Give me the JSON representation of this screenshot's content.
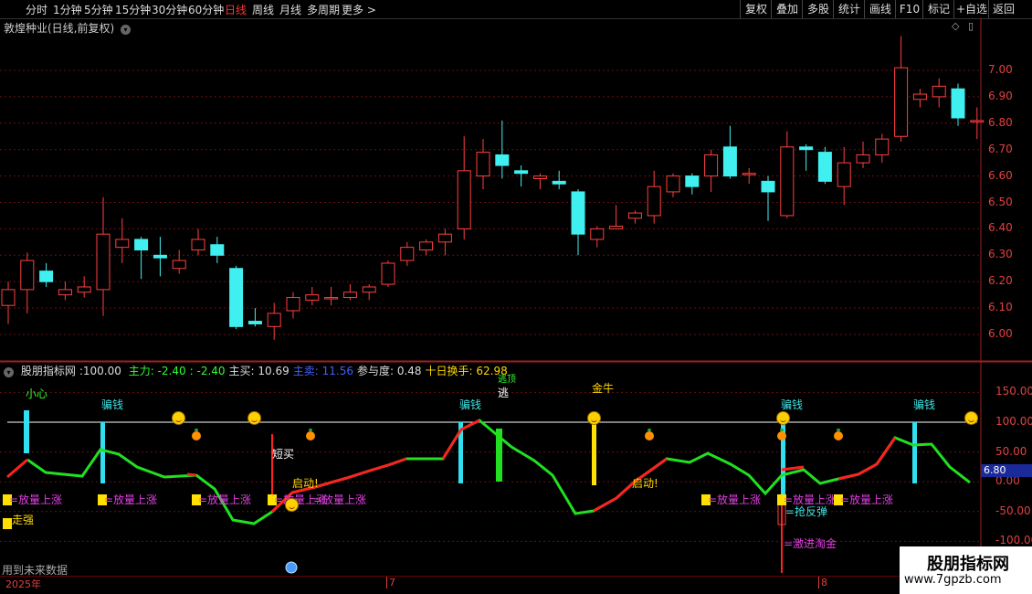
{
  "toolbar": {
    "periods": [
      "分时",
      "1分钟",
      "5分钟",
      "15分钟",
      "30分钟",
      "60分钟",
      "日线",
      "周线",
      "月线",
      "多周期",
      "更多 >"
    ],
    "active_period": "日线",
    "right_buttons": [
      "复权",
      "叠加",
      "多股",
      "统计",
      "画线",
      "F10",
      "标记",
      "+自选",
      "返回"
    ]
  },
  "main_panel": {
    "title": "敦煌种业(日线,前复权)",
    "y_labels": [
      "7.00",
      "6.90",
      "6.80",
      "6.70",
      "6.60",
      "6.50",
      "6.40",
      "6.30",
      "6.20",
      "6.10",
      "6.00"
    ]
  },
  "indicator": {
    "name": "股朋指标网",
    "param": ":100.00",
    "items": [
      {
        "text": "主力: -2.40",
        "color": "#30ff30"
      },
      {
        "text": ": -2.40",
        "color": "#30ff30"
      },
      {
        "text": "主买: 10.69",
        "color": "#dddddd"
      },
      {
        "text": "主卖: 11.56",
        "color": "#4060ff"
      },
      {
        "text": "参与度: 0.48",
        "color": "#dddddd"
      },
      {
        "text": "十日换手: 62.98",
        "color": "#ffd700"
      }
    ],
    "y_labels": [
      "150.00",
      "100.00",
      "50.00",
      "0.00",
      "-50.00",
      "-100.00"
    ],
    "current_price": "6.80"
  },
  "labels": {
    "xiaoxin": "小心",
    "pianqian": "骗钱",
    "jinniu": "金牛",
    "tao": "逃",
    "taotop": "逃顶",
    "duanmai": "短买",
    "qidong": "启动!",
    "zouqiang": "走强",
    "fangliang": "=放量上涨",
    "qiangfantan": "=抢反弹",
    "jijin": "=激进淘金",
    "future": "用到未来数据",
    "qidong2": "启动"
  },
  "timeline": {
    "y2025": "2025年",
    "m7": "7",
    "m8": "8"
  },
  "watermark": {
    "name": "股朋指标网",
    "url": "www.7gpzb.com"
  },
  "chart_data": {
    "type": "candlestick",
    "title": "敦煌种业(日线,前复权)",
    "ylim": [
      5.95,
      7.1
    ],
    "candles": [
      {
        "o": 6.11,
        "c": 6.17,
        "h": 6.2,
        "l": 6.04
      },
      {
        "o": 6.17,
        "c": 6.28,
        "h": 6.31,
        "l": 6.08
      },
      {
        "o": 6.24,
        "c": 6.2,
        "h": 6.27,
        "l": 6.18
      },
      {
        "o": 6.15,
        "c": 6.17,
        "h": 6.2,
        "l": 6.13
      },
      {
        "o": 6.16,
        "c": 6.18,
        "h": 6.22,
        "l": 6.14
      },
      {
        "o": 6.17,
        "c": 6.38,
        "h": 6.52,
        "l": 6.07
      },
      {
        "o": 6.33,
        "c": 6.36,
        "h": 6.44,
        "l": 6.27
      },
      {
        "o": 6.36,
        "c": 6.32,
        "h": 6.37,
        "l": 6.21
      },
      {
        "o": 6.3,
        "c": 6.29,
        "h": 6.37,
        "l": 6.22
      },
      {
        "o": 6.25,
        "c": 6.28,
        "h": 6.32,
        "l": 6.23
      },
      {
        "o": 6.32,
        "c": 6.36,
        "h": 6.4,
        "l": 6.3
      },
      {
        "o": 6.34,
        "c": 6.3,
        "h": 6.37,
        "l": 6.27
      },
      {
        "o": 6.25,
        "c": 6.03,
        "h": 6.26,
        "l": 6.02
      },
      {
        "o": 6.05,
        "c": 6.04,
        "h": 6.1,
        "l": 6.03
      },
      {
        "o": 6.03,
        "c": 6.08,
        "h": 6.12,
        "l": 5.98
      },
      {
        "o": 6.09,
        "c": 6.14,
        "h": 6.16,
        "l": 6.06
      },
      {
        "o": 6.13,
        "c": 6.15,
        "h": 6.18,
        "l": 6.11
      },
      {
        "o": 6.14,
        "c": 6.14,
        "h": 6.18,
        "l": 6.11
      },
      {
        "o": 6.14,
        "c": 6.16,
        "h": 6.19,
        "l": 6.13
      },
      {
        "o": 6.16,
        "c": 6.18,
        "h": 6.19,
        "l": 6.13
      },
      {
        "o": 6.19,
        "c": 6.27,
        "h": 6.28,
        "l": 6.18
      },
      {
        "o": 6.28,
        "c": 6.33,
        "h": 6.35,
        "l": 6.26
      },
      {
        "o": 6.32,
        "c": 6.35,
        "h": 6.36,
        "l": 6.3
      },
      {
        "o": 6.35,
        "c": 6.38,
        "h": 6.4,
        "l": 6.3
      },
      {
        "o": 6.4,
        "c": 6.62,
        "h": 6.75,
        "l": 6.36
      },
      {
        "o": 6.6,
        "c": 6.69,
        "h": 6.74,
        "l": 6.55
      },
      {
        "o": 6.68,
        "c": 6.64,
        "h": 6.81,
        "l": 6.59
      },
      {
        "o": 6.62,
        "c": 6.61,
        "h": 6.64,
        "l": 6.56
      },
      {
        "o": 6.59,
        "c": 6.6,
        "h": 6.61,
        "l": 6.55
      },
      {
        "o": 6.58,
        "c": 6.57,
        "h": 6.62,
        "l": 6.55
      },
      {
        "o": 6.54,
        "c": 6.38,
        "h": 6.55,
        "l": 6.3
      },
      {
        "o": 6.36,
        "c": 6.4,
        "h": 6.41,
        "l": 6.33
      },
      {
        "o": 6.4,
        "c": 6.41,
        "h": 6.49,
        "l": 6.4
      },
      {
        "o": 6.44,
        "c": 6.46,
        "h": 6.47,
        "l": 6.42
      },
      {
        "o": 6.45,
        "c": 6.56,
        "h": 6.62,
        "l": 6.42
      },
      {
        "o": 6.54,
        "c": 6.6,
        "h": 6.61,
        "l": 6.52
      },
      {
        "o": 6.6,
        "c": 6.56,
        "h": 6.61,
        "l": 6.53
      },
      {
        "o": 6.6,
        "c": 6.68,
        "h": 6.7,
        "l": 6.54
      },
      {
        "o": 6.71,
        "c": 6.6,
        "h": 6.79,
        "l": 6.59
      },
      {
        "o": 6.61,
        "c": 6.61,
        "h": 6.63,
        "l": 6.57
      },
      {
        "o": 6.58,
        "c": 6.54,
        "h": 6.6,
        "l": 6.43
      },
      {
        "o": 6.45,
        "c": 6.71,
        "h": 6.77,
        "l": 6.44
      },
      {
        "o": 6.71,
        "c": 6.7,
        "h": 6.72,
        "l": 6.62
      },
      {
        "o": 6.69,
        "c": 6.58,
        "h": 6.71,
        "l": 6.57
      },
      {
        "o": 6.56,
        "c": 6.65,
        "h": 6.71,
        "l": 6.49
      },
      {
        "o": 6.65,
        "c": 6.68,
        "h": 6.73,
        "l": 6.63
      },
      {
        "o": 6.68,
        "c": 6.74,
        "h": 6.76,
        "l": 6.65
      },
      {
        "o": 6.75,
        "c": 7.01,
        "h": 7.13,
        "l": 6.73
      },
      {
        "o": 6.89,
        "c": 6.91,
        "h": 6.93,
        "l": 6.86
      },
      {
        "o": 6.9,
        "c": 6.94,
        "h": 6.97,
        "l": 6.86
      },
      {
        "o": 6.93,
        "c": 6.82,
        "h": 6.95,
        "l": 6.79
      },
      {
        "o": 6.81,
        "c": 6.81,
        "h": 6.86,
        "l": 6.74
      }
    ]
  }
}
